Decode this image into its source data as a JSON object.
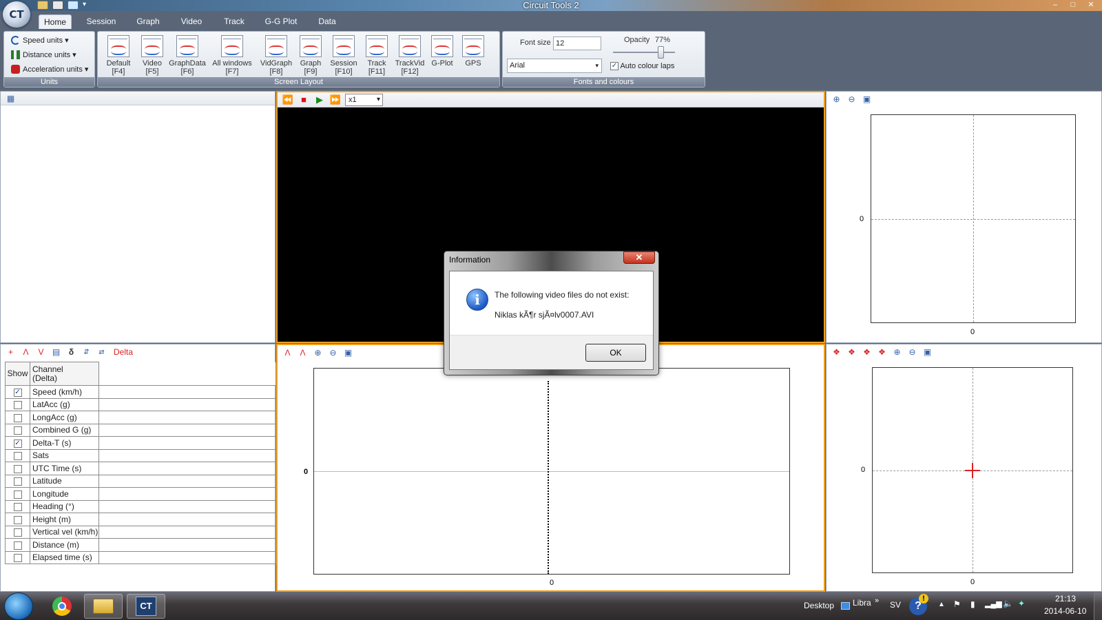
{
  "app": {
    "title": "Circuit Tools 2",
    "orb_label": "CT"
  },
  "window_controls": [
    "–",
    "□",
    "✕"
  ],
  "tabs": [
    {
      "label": "Home",
      "active": true
    },
    {
      "label": "Session"
    },
    {
      "label": "Graph"
    },
    {
      "label": "Video"
    },
    {
      "label": "Track"
    },
    {
      "label": "G-G Plot"
    },
    {
      "label": "Data"
    }
  ],
  "ribbon": {
    "units": {
      "label": "Units",
      "items": [
        {
          "label": "Speed units ▾",
          "icon": "speedometer-icon",
          "color": "#1e5ab5"
        },
        {
          "label": "Distance units ▾",
          "icon": "distance-icon",
          "color": "#2d7a2d"
        },
        {
          "label": "Acceleration units ▾",
          "icon": "acceleration-icon",
          "color": "#c62020"
        }
      ]
    },
    "layout": {
      "label": "Screen Layout",
      "buttons": [
        {
          "name": "Default",
          "key": "[F4]"
        },
        {
          "name": "Video",
          "key": "[F5]"
        },
        {
          "name": "GraphData",
          "key": "[F6]"
        },
        {
          "name": "All windows",
          "key": "[F7]"
        },
        {
          "name": "VidGraph",
          "key": "[F8]"
        },
        {
          "name": "Graph",
          "key": "[F9]"
        },
        {
          "name": "Session",
          "key": "[F10]"
        },
        {
          "name": "Track",
          "key": "[F11]"
        },
        {
          "name": "TrackVid",
          "key": "[F12]"
        },
        {
          "name": "G-Plot",
          "key": ""
        },
        {
          "name": "GPS",
          "key": ""
        }
      ]
    },
    "fonts": {
      "label": "Fonts and colours",
      "font_size_label": "Font size",
      "font_size_value": "12",
      "opacity_label": "Opacity",
      "opacity_value": "77%",
      "opacity_fraction": 0.77,
      "font_name": "Arial",
      "auto_colour_label": "Auto colour laps",
      "auto_colour_checked": true
    }
  },
  "video": {
    "speed": "x1"
  },
  "data_panel": {
    "delta_label": "Delta",
    "col_show": "Show",
    "col_channel_line1": "Channel",
    "col_channel_line2": "(Delta)",
    "channels": [
      {
        "name": "Speed (km/h)",
        "checked": true
      },
      {
        "name": "LatAcc (g)",
        "checked": false
      },
      {
        "name": "LongAcc (g)",
        "checked": false
      },
      {
        "name": "Combined G (g)",
        "checked": false
      },
      {
        "name": "Delta-T (s)",
        "checked": true
      },
      {
        "name": "Sats",
        "checked": false
      },
      {
        "name": "UTC Time (s)",
        "checked": false
      },
      {
        "name": "Latitude",
        "checked": false
      },
      {
        "name": "Longitude",
        "checked": false
      },
      {
        "name": "Heading (°)",
        "checked": false
      },
      {
        "name": "Height (m)",
        "checked": false
      },
      {
        "name": "Vertical vel (km/h)",
        "checked": false
      },
      {
        "name": "Distance (m)",
        "checked": false
      },
      {
        "name": "Elapsed time (s)",
        "checked": false
      }
    ]
  },
  "plots": {
    "track_axis_y": "0",
    "track_axis_x": "0",
    "graph_axis_y": "0",
    "graph_axis_x": "0",
    "gg_axis_y": "0",
    "gg_axis_x": "0"
  },
  "dialog": {
    "title": "Information",
    "close": "✕",
    "message": "The following video files do not exist:",
    "file": "Niklas kÃ¶r sjÃ¤lv0007.AVI",
    "ok": "OK"
  },
  "taskbar": {
    "desktop_label": "Desktop",
    "folder_label": "Libra",
    "chevron": "»",
    "language": "SV",
    "time": "21:13",
    "date": "2014-06-10"
  },
  "colors": {
    "accent": "#f1a01f",
    "delta": "#d22222",
    "ribbon_bg": "#5a6678"
  }
}
